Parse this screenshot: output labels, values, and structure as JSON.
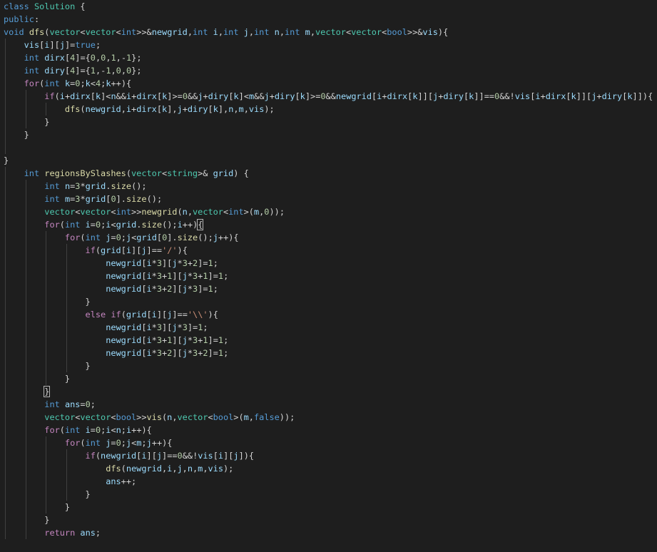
{
  "editor": {
    "language": "cpp",
    "lines": [
      "class Solution {",
      "public:",
      "void dfs(vector<vector<int>>&newgrid,int i,int j,int n,int m,vector<vector<bool>>&vis){",
      "    vis[i][j]=true;",
      "    int dirx[4]={0,0,1,-1};",
      "    int diry[4]={1,-1,0,0};",
      "    for(int k=0;k<4;k++){",
      "        if(i+dirx[k]<n&&i+dirx[k]>=0&&j+diry[k]<m&&j+diry[k]>=0&&newgrid[i+dirx[k]][j+diry[k]]==0&&!vis[i+dirx[k]][j+diry[k]]){",
      "            dfs(newgrid,i+dirx[k],j+diry[k],n,m,vis);",
      "        }",
      "    }",
      "",
      "}",
      "    int regionsBySlashes(vector<string>& grid) {",
      "        int n=3*grid.size();",
      "        int m=3*grid[0].size();",
      "        vector<vector<int>>newgrid(n,vector<int>(m,0));",
      "        for(int i=0;i<grid.size();i++){",
      "            for(int j=0;j<grid[0].size();j++){",
      "                if(grid[i][j]=='/'){",
      "                    newgrid[i*3][j*3+2]=1;",
      "                    newgrid[i*3+1][j*3+1]=1;",
      "                    newgrid[i*3+2][j*3]=1;",
      "                }",
      "                else if(grid[i][j]=='\\\\'){",
      "                    newgrid[i*3][j*3]=1;",
      "                    newgrid[i*3+1][j*3+1]=1;",
      "                    newgrid[i*3+2][j*3+2]=1;",
      "                }",
      "            }",
      "        }",
      "        int ans=0;",
      "        vector<vector<bool>>vis(n,vector<bool>(m,false));",
      "        for(int i=0;i<n;i++){",
      "            for(int j=0;j<m;j++){",
      "                if(newgrid[i][j]==0&&!vis[i][j]){",
      "                    dfs(newgrid,i,j,n,m,vis);",
      "                    ans++;",
      "                }",
      "            }",
      "        }",
      "        return ans;"
    ],
    "highlighted_brackets": [
      {
        "line": 17,
        "text": "{"
      },
      {
        "line": 30,
        "text": "}"
      }
    ]
  },
  "colors": {
    "background": "#1e1e1e",
    "keyword": "#569cd6",
    "type": "#4ec9b0",
    "function": "#dcdcaa",
    "variable": "#9cdcfe",
    "number": "#b5cea8",
    "string": "#ce9178",
    "control": "#c586c0",
    "plain": "#d4d4d4"
  }
}
